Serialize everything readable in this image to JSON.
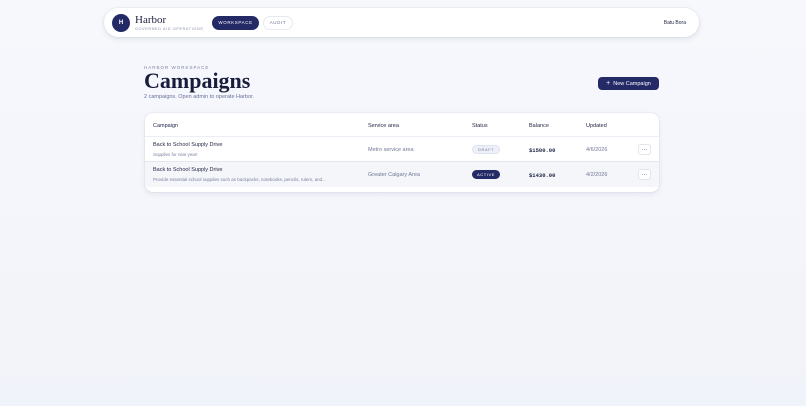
{
  "nav": {
    "logo_letter": "H",
    "brand_name": "Harbor",
    "brand_tagline": "GOVERNED AID OPERATIONS",
    "tabs": [
      {
        "label": "WORKSPACE",
        "active": true
      },
      {
        "label": "AUDIT",
        "active": false
      }
    ],
    "user_name": "Batu Bora"
  },
  "header": {
    "eyebrow": "HARBOR WORKSPACE",
    "title": "Campaigns",
    "subtitle": "2 campaigns. Open admin to operate Harbor.",
    "new_button_label": "New Campaign",
    "new_button_icon": "+"
  },
  "table": {
    "columns": [
      "Campaign",
      "Service area",
      "Status",
      "Balance",
      "Updated"
    ],
    "rows": [
      {
        "title": "Back to School Supply Drive",
        "description": "Supplies for new year!",
        "service_area": "Metro service area",
        "status": "DRAFT",
        "balance": "$1500.00",
        "updated": "4/6/2026",
        "more": "···"
      },
      {
        "title": "Back to School Supply Drive",
        "description": "Provide essential school supplies such as backpacks, notebooks, pencils, rulers, and...",
        "service_area": "Greater Calgary Area",
        "status": "ACTIVE",
        "balance": "$1430.00",
        "updated": "4/2/2026",
        "more": "···"
      }
    ]
  },
  "colors": {
    "accent": "#232a66",
    "background": "#f4f5fb",
    "muted_text": "#727896"
  }
}
